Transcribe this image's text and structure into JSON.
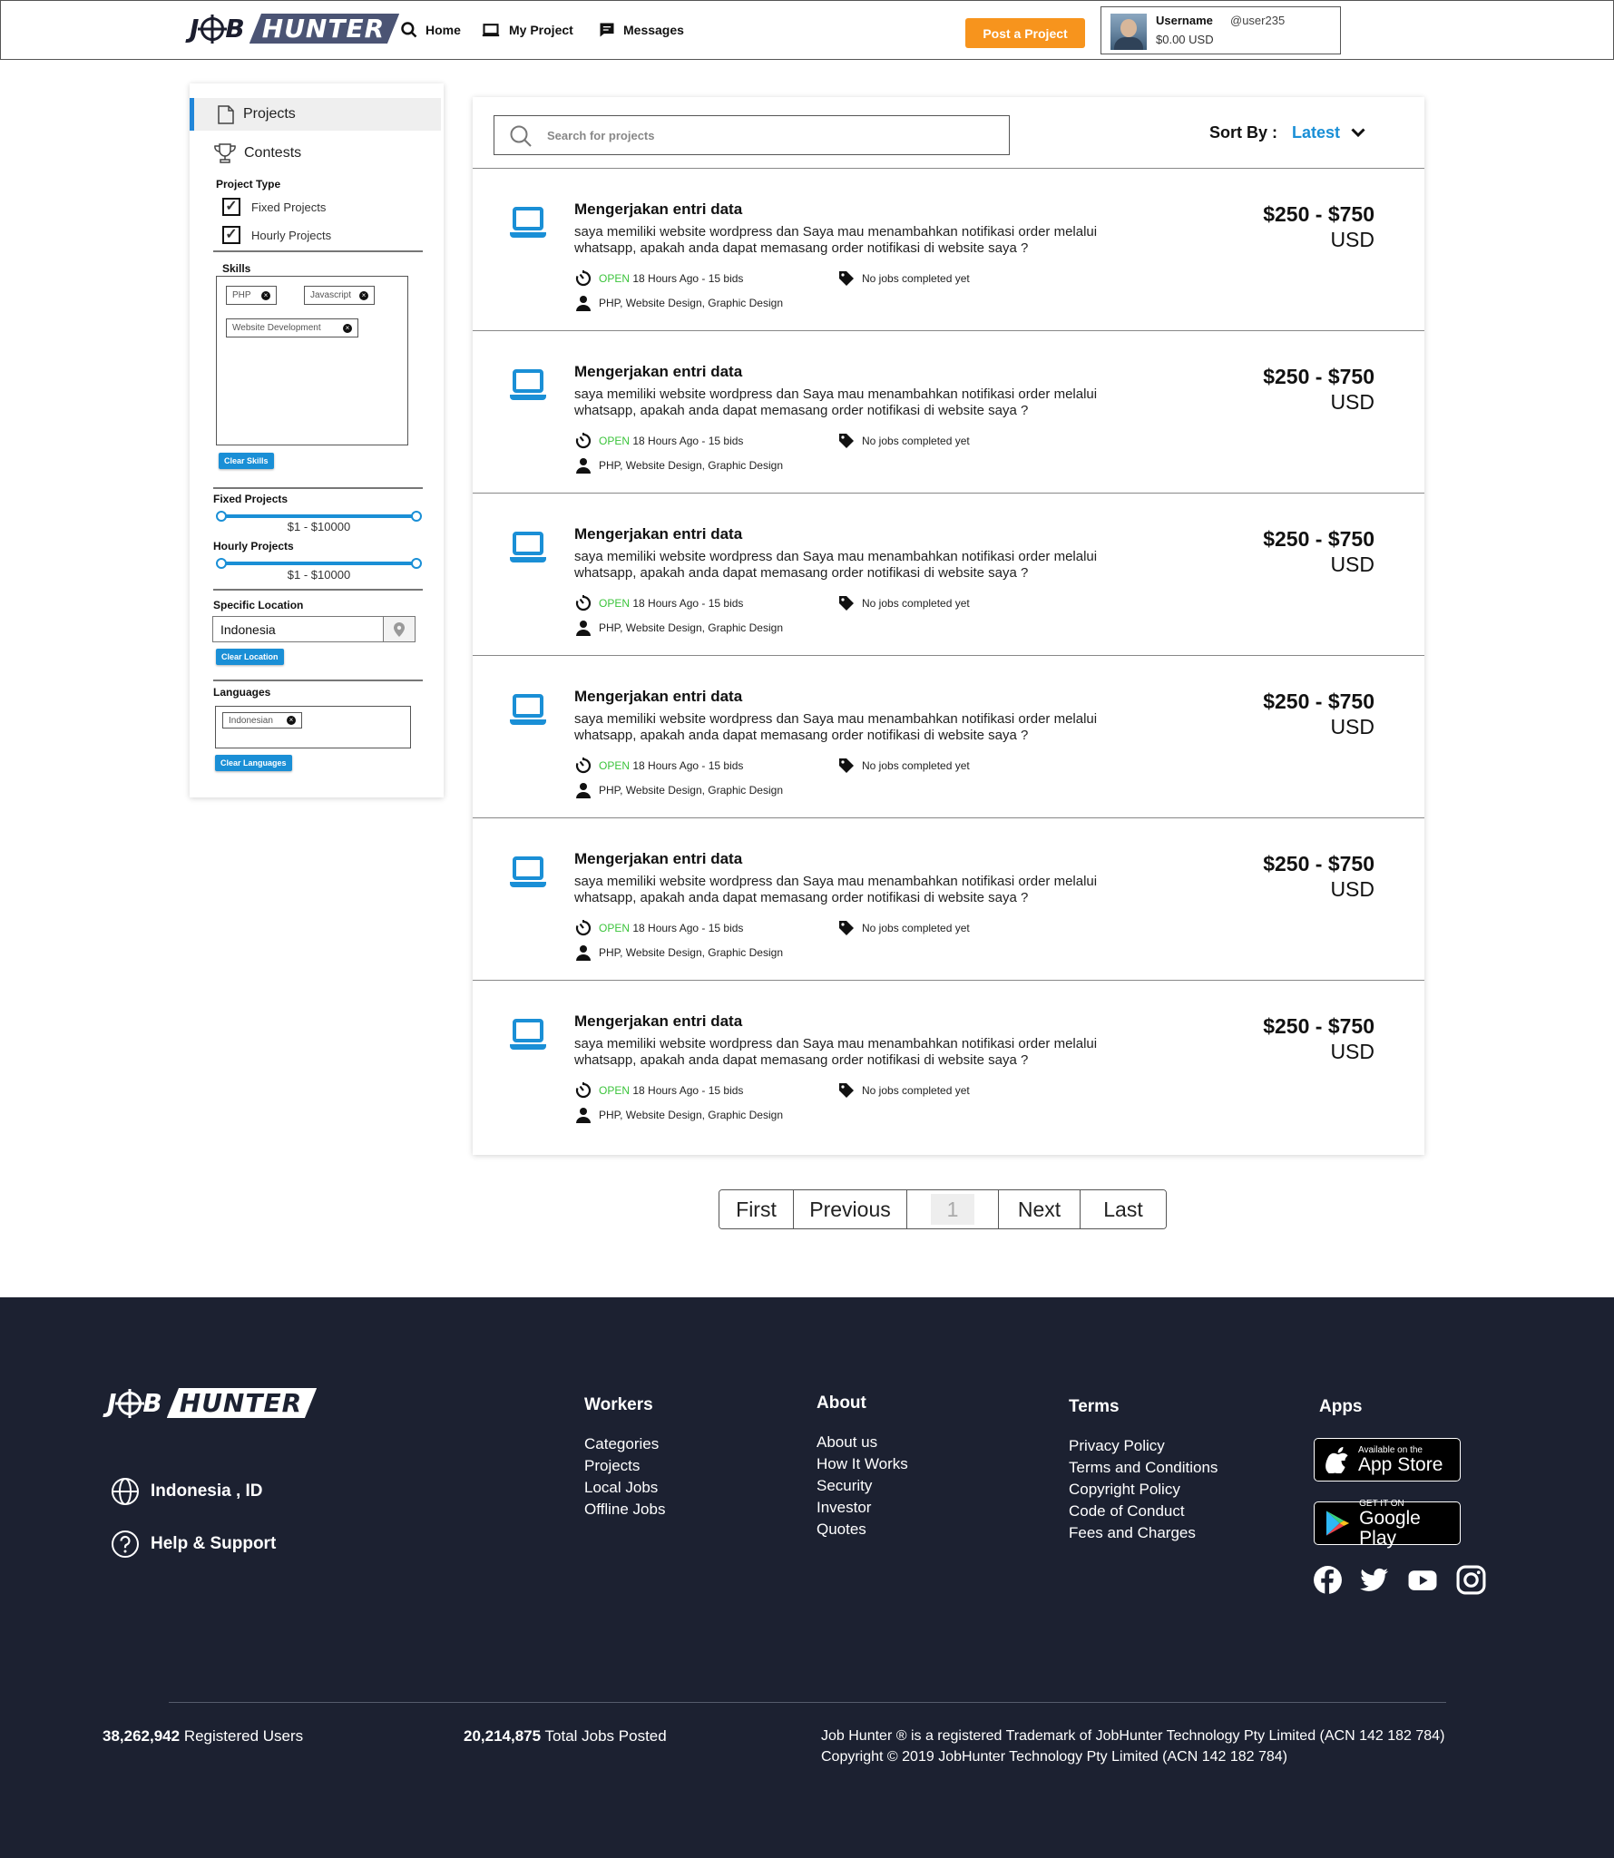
{
  "header": {
    "logo": {
      "left": "J",
      "right_of_target": "B",
      "box": "HUNTER"
    },
    "nav": [
      {
        "label": "Home",
        "icon": "search-icon"
      },
      {
        "label": "My Project",
        "icon": "laptop-icon"
      },
      {
        "label": "Messages",
        "icon": "message-icon"
      }
    ],
    "post_button": "Post a Project",
    "user": {
      "username": "Username",
      "handle": "@user235",
      "balance": "$0.00 USD"
    }
  },
  "sidebar": {
    "projects_label": "Projects",
    "contests_label": "Contests",
    "project_type_heading": "Project Type",
    "fixed_projects_label": "Fixed Projects",
    "fixed_projects_checked": true,
    "hourly_projects_label": "Hourly Projects",
    "hourly_projects_checked": true,
    "skills_heading": "Skills",
    "skills": [
      "PHP",
      "Javascript",
      "Website Development"
    ],
    "clear_skills": "Clear Skills",
    "fixed_range_heading": "Fixed Projects",
    "fixed_range_label": "$1 - $10000",
    "hourly_range_heading": "Hourly Projects",
    "hourly_range_label": "$1 - $10000",
    "location_heading": "Specific Location",
    "location_value": "Indonesia",
    "clear_location": "Clear Location",
    "languages_heading": "Languages",
    "languages": [
      "Indonesian"
    ],
    "clear_languages": "Clear Languages"
  },
  "search": {
    "placeholder": "Search for projects",
    "value": ""
  },
  "sort": {
    "label": "Sort By :",
    "value": "Latest"
  },
  "projects": [
    {
      "title": "Mengerjakan entri data",
      "description": "saya memiliki website wordpress dan Saya mau menambahkan notifikasi order melalui whatsapp, apakah anda dapat memasang order notifikasi di website saya ?",
      "price_range": "$250 - $750",
      "currency": "USD",
      "status": "OPEN",
      "posted": "18 Hours Ago - 15 bids",
      "completed": "No jobs completed yet",
      "skills": "PHP, Website Design, Graphic Design"
    },
    {
      "title": "Mengerjakan entri data",
      "description": "saya memiliki website wordpress dan Saya mau menambahkan notifikasi order melalui whatsapp, apakah anda dapat memasang order notifikasi di website saya ?",
      "price_range": "$250 - $750",
      "currency": "USD",
      "status": "OPEN",
      "posted": "18 Hours Ago - 15 bids",
      "completed": "No jobs completed yet",
      "skills": "PHP, Website Design, Graphic Design"
    },
    {
      "title": "Mengerjakan entri data",
      "description": "saya memiliki website wordpress dan Saya mau menambahkan notifikasi order melalui whatsapp, apakah anda dapat memasang order notifikasi di website saya ?",
      "price_range": "$250 - $750",
      "currency": "USD",
      "status": "OPEN",
      "posted": "18 Hours Ago - 15 bids",
      "completed": "No jobs completed yet",
      "skills": "PHP, Website Design, Graphic Design"
    },
    {
      "title": "Mengerjakan entri data",
      "description": "saya memiliki website wordpress dan Saya mau menambahkan notifikasi order melalui whatsapp, apakah anda dapat memasang order notifikasi di website saya ?",
      "price_range": "$250 - $750",
      "currency": "USD",
      "status": "OPEN",
      "posted": "18 Hours Ago - 15 bids",
      "completed": "No jobs completed yet",
      "skills": "PHP, Website Design, Graphic Design"
    },
    {
      "title": "Mengerjakan entri data",
      "description": "saya memiliki website wordpress dan Saya mau menambahkan notifikasi order melalui whatsapp, apakah anda dapat memasang order notifikasi di website saya ?",
      "price_range": "$250 - $750",
      "currency": "USD",
      "status": "OPEN",
      "posted": "18 Hours Ago - 15 bids",
      "completed": "No jobs completed yet",
      "skills": "PHP, Website Design, Graphic Design"
    },
    {
      "title": "Mengerjakan entri data",
      "description": "saya memiliki website wordpress dan Saya mau menambahkan notifikasi order melalui whatsapp, apakah anda dapat memasang order notifikasi di website saya ?",
      "price_range": "$250 - $750",
      "currency": "USD",
      "status": "OPEN",
      "posted": "18 Hours Ago - 15 bids",
      "completed": "No jobs completed yet",
      "skills": "PHP, Website Design, Graphic Design"
    }
  ],
  "pagination": {
    "first": "First",
    "previous": "Previous",
    "current": "1",
    "next": "Next",
    "last": "Last"
  },
  "footer": {
    "location": "Indonesia , ID",
    "help": "Help & Support",
    "workers": {
      "title": "Workers",
      "links": [
        "Categories",
        "Projects",
        "Local Jobs",
        "Offline Jobs"
      ]
    },
    "about": {
      "title": "About",
      "links": [
        "About us",
        "How It Works",
        "Security",
        "Investor",
        "Quotes"
      ]
    },
    "terms": {
      "title": "Terms",
      "links": [
        "Privacy Policy",
        "Terms and Conditions",
        "Copyright Policy",
        "Code of Conduct",
        "Fees and Charges"
      ]
    },
    "apps": {
      "title": "Apps",
      "app_store": {
        "small": "Available on the",
        "big": "App Store"
      },
      "google_play": {
        "small": "GET IT ON",
        "big": "Google Play"
      }
    },
    "socials": [
      "facebook-icon",
      "twitter-icon",
      "youtube-icon",
      "instagram-icon"
    ],
    "stats": {
      "users_count": "38,262,942",
      "users_label": "Registered Users",
      "jobs_count": "20,214,875",
      "jobs_label": "Total Jobs Posted"
    },
    "legal_line1": "Job Hunter ® is a registered Trademark of JobHunter Technology Pty Limited (ACN 142 182 784)",
    "legal_line2": "Copyright © 2019 JobHunter Technology Pty Limited (ACN 142 182 784)"
  },
  "colors": {
    "accent_blue": "#1a8fd6",
    "orange": "#f7941d",
    "open_green": "#3cc43c",
    "footer_bg": "#1c2131"
  }
}
